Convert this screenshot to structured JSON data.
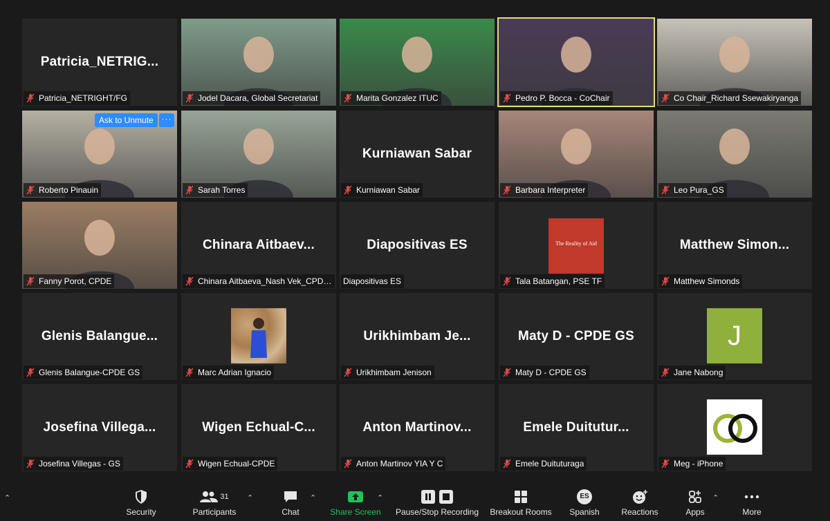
{
  "tiles": [
    {
      "name": "Patricia_NETRIGHT/FG",
      "center": "Patricia_NETRIG...",
      "type": "name"
    },
    {
      "name": "Jodel Dacara, Global Secretariat",
      "type": "photo",
      "bg": "#7f9c8a"
    },
    {
      "name": "Marita Gonzalez ITUC",
      "type": "photo",
      "bg": "#3a8a4a"
    },
    {
      "name": "Pedro P. Bocca - CoChair",
      "type": "photo",
      "bg": "#4a3b55",
      "active": true
    },
    {
      "name": "Co Chair_Richard Ssewakiryanga",
      "type": "photo",
      "bg": "#c7c2b8"
    },
    {
      "name": "Roberto Pinauin",
      "type": "photo",
      "bg": "#b5b0a3",
      "ask": "Ask to Unmute",
      "more": "···"
    },
    {
      "name": "Sarah Torres",
      "type": "photo",
      "bg": "#97a596"
    },
    {
      "name": "Kurniawan Sabar",
      "center": "Kurniawan Sabar",
      "type": "name"
    },
    {
      "name": "Barbara Interpreter",
      "type": "photo",
      "bg": "#a88679"
    },
    {
      "name": "Leo Pura_GS",
      "type": "photo",
      "bg": "#7b7b73"
    },
    {
      "name": "Fanny Porot, CPDE",
      "type": "photo",
      "bg": "#9c7d62"
    },
    {
      "name": "Chinara Aitbaeva_Nash Vek_CPDE ...",
      "center": "Chinara  Aitbaev...",
      "type": "name"
    },
    {
      "name": "Diapositivas ES",
      "center": "Diapositivas ES",
      "type": "name",
      "nomute": true
    },
    {
      "name": "Tala Batangan, PSE TF",
      "type": "reality",
      "logo_text": "The Reality of Aid"
    },
    {
      "name": "Matthew Simonds",
      "center": "Matthew  Simon...",
      "type": "name"
    },
    {
      "name": "Glenis Balangue-CPDE GS",
      "center": "Glenis  Balangue...",
      "type": "name"
    },
    {
      "name": "Marc Adrian Ignacio",
      "type": "marc"
    },
    {
      "name": "Urikhimbam Jenison",
      "center": "Urikhimbam  Je...",
      "type": "name"
    },
    {
      "name": "Maty D - CPDE GS",
      "center": "Maty D - CPDE GS",
      "type": "name"
    },
    {
      "name": "Jane Nabong",
      "type": "avatar",
      "initial": "J"
    },
    {
      "name": "Josefina Villegas - GS",
      "center": "Josefina  Villega...",
      "type": "name"
    },
    {
      "name": "Wigen Echual-CPDE",
      "center": "Wigen  Echual-C...",
      "type": "name"
    },
    {
      "name": "Anton Martinov YIA Y C",
      "center": "Anton  Martinov...",
      "type": "name"
    },
    {
      "name": "Emele Duituturaga",
      "center": "Emele  Duitutur...",
      "type": "name"
    },
    {
      "name": "Meg - iPhone",
      "type": "logo"
    }
  ],
  "toolbar": {
    "security": "Security",
    "participants": "Participants",
    "participants_count": "31",
    "chat": "Chat",
    "share_screen": "Share Screen",
    "recording": "Pause/Stop Recording",
    "breakout": "Breakout Rooms",
    "spanish": "Spanish",
    "spanish_badge": "ES",
    "reactions": "Reactions",
    "apps": "Apps",
    "more": "More"
  },
  "colors": {
    "active_border": "#e8d978",
    "accent_blue": "#2d8cff",
    "share_green": "#23c05a",
    "mute_red": "#e04a4a"
  }
}
